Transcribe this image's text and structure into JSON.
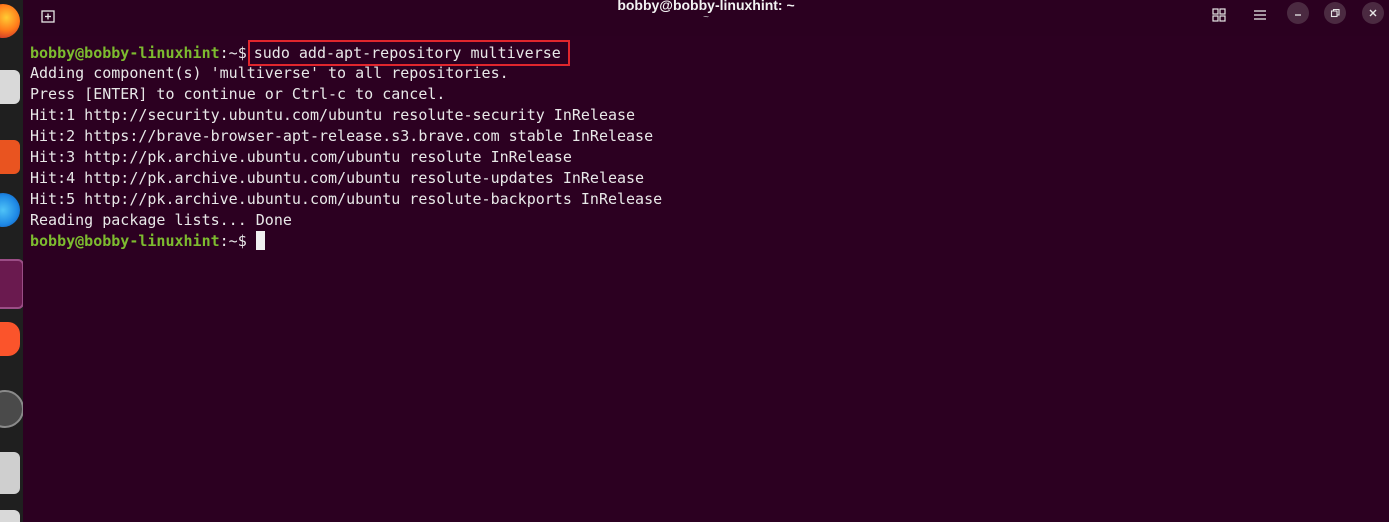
{
  "window": {
    "title": "bobby@bobby-linuxhint: ~",
    "subtitle": "~"
  },
  "titlebar_buttons": {
    "new_tab_icon": "new-tab-icon",
    "grid_icon": "grid-view-icon",
    "menu_icon": "hamburger-menu-icon",
    "minimize_icon": "minimize-icon",
    "restore_icon": "restore-icon",
    "close_icon": "close-icon"
  },
  "dock": {
    "apps": [
      "firefox-icon",
      "files-icon",
      "app-store-icon",
      "browser-icon",
      "terminal-icon",
      "brave-icon",
      "clock-icon",
      "disk-icon",
      "extra-app-icon"
    ]
  },
  "terminal": {
    "prompt_user": "bobby@bobby-linuxhint",
    "prompt_sep": ":~$",
    "command": "sudo add-apt-repository multiverse",
    "output": [
      "Adding component(s) 'multiverse' to all repositories.",
      "Press [ENTER] to continue or Ctrl-c to cancel.",
      "Hit:1 http://security.ubuntu.com/ubuntu resolute-security InRelease",
      "Hit:2 https://brave-browser-apt-release.s3.brave.com stable InRelease",
      "Hit:3 http://pk.archive.ubuntu.com/ubuntu resolute InRelease",
      "Hit:4 http://pk.archive.ubuntu.com/ubuntu resolute-updates InRelease",
      "Hit:5 http://pk.archive.ubuntu.com/ubuntu resolute-backports InRelease",
      "Reading package lists... Done"
    ],
    "final_prompt_user": "bobby@bobby-linuxhint",
    "final_prompt_sep": ":~$"
  },
  "colors": {
    "background": "#2c0021",
    "prompt_user": "#7dbb2f",
    "highlight_box": "#e0262d",
    "text": "#e8e8e8"
  }
}
